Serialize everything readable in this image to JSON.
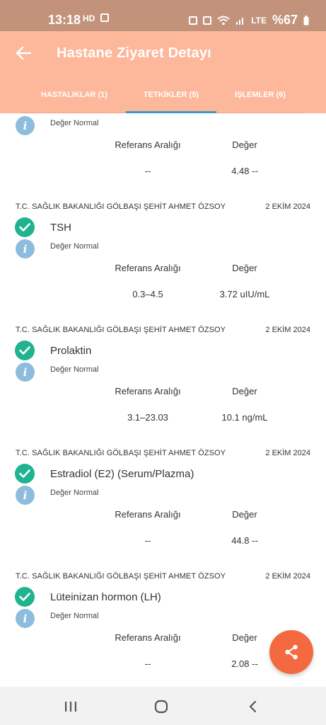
{
  "statusbar": {
    "time": "13:18",
    "hd_badge": "HD",
    "battery": "%67",
    "lte": "LTE",
    "icons": [
      "gallery-icon",
      "alarm-icon",
      "mute-icon",
      "wifi-icon",
      "signal-icon",
      "battery-icon"
    ]
  },
  "appbar": {
    "title": "Hastane Ziyaret Detayı",
    "back_icon": "arrow-left-icon"
  },
  "tabs": [
    {
      "label": "HASTALIKLAR (1)"
    },
    {
      "label": "TETKİKLER (5)",
      "active": true
    },
    {
      "label": "İŞLEMLER (6)"
    }
  ],
  "columns": {
    "ref_label": "Referans Aralığı",
    "value_label": "Değer"
  },
  "results": [
    {
      "source": "",
      "date": "",
      "name": "",
      "status": "Değer Normal",
      "reference": "--",
      "value": "4.48 --"
    },
    {
      "source": "T.C. SAĞLIK BAKANLIĞI GÖLBAŞI ŞEHİT AHMET ÖZSOY",
      "date": "2 EKİM 2024",
      "name": "TSH",
      "status": "Değer Normal",
      "reference": "0.3–4.5",
      "value": "3.72 uIU/mL"
    },
    {
      "source": "T.C. SAĞLIK BAKANLIĞI GÖLBAŞI ŞEHİT AHMET ÖZSOY",
      "date": "2 EKİM 2024",
      "name": "Prolaktin",
      "status": "Değer Normal",
      "reference": "3.1–23.03",
      "value": "10.1 ng/mL"
    },
    {
      "source": "T.C. SAĞLIK BAKANLIĞI GÖLBAŞI ŞEHİT AHMET ÖZSOY",
      "date": "2 EKİM 2024",
      "name": "Estradiol (E2) (Serum/Plazma)",
      "status": "Değer Normal",
      "reference": "--",
      "value": "44.8 --"
    },
    {
      "source": "T.C. SAĞLIK BAKANLIĞI GÖLBAŞI ŞEHİT AHMET ÖZSOY",
      "date": "2 EKİM 2024",
      "name": "Lüteinizan hormon (LH)",
      "status": "Değer Normal",
      "reference": "--",
      "value": "2.08 --"
    }
  ],
  "fab": {
    "icon": "share-icon"
  },
  "navbar": {
    "icons": [
      "recents-icon",
      "home-icon",
      "back-icon"
    ]
  },
  "colors": {
    "header": "#FDB79A",
    "statusbar": "#C2937A",
    "tab_indicator": "#3A9BC7",
    "check": "#1FB38F",
    "info": "#8EBCDC",
    "fab": "#F4693F"
  }
}
